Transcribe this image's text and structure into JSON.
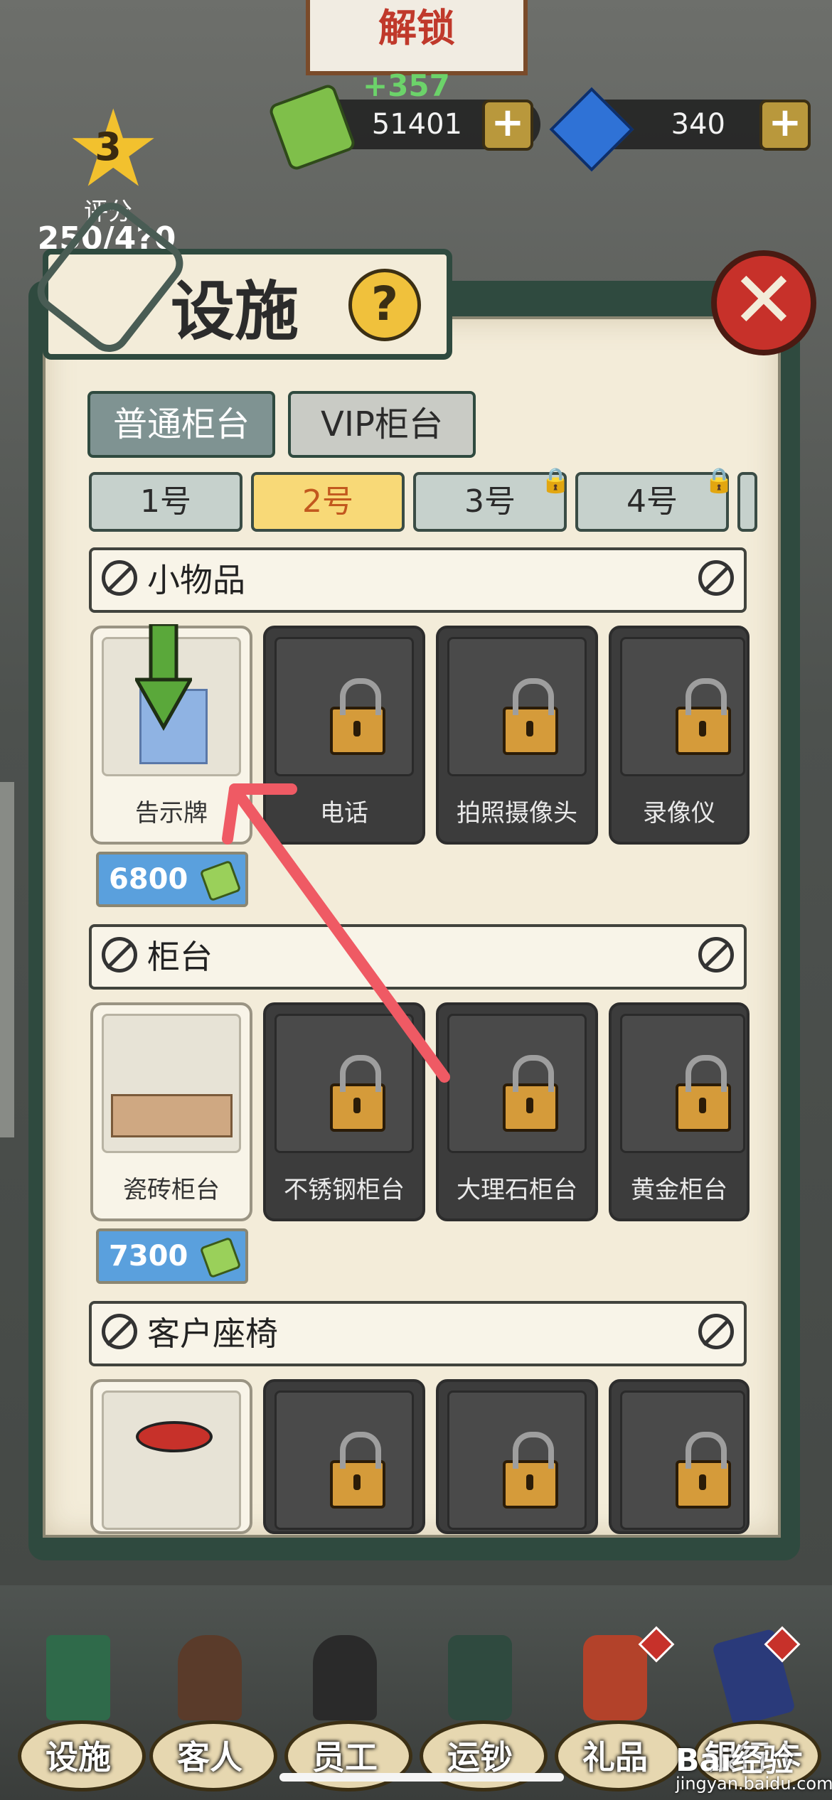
{
  "hud": {
    "sign_line2": "解锁",
    "cash_gain": "+357",
    "cash_value": "51401",
    "gem_value": "340",
    "rating_level": "3",
    "rating_label": "评分",
    "rating_value": "250/4?0"
  },
  "dialog": {
    "title": "设施",
    "help_symbol": "?",
    "close_symbol": "✕",
    "tabs": [
      {
        "label": "普通柜台",
        "active": true
      },
      {
        "label": "VIP柜台",
        "active": false
      }
    ],
    "slots": [
      {
        "label": "1号",
        "active": false,
        "locked": false
      },
      {
        "label": "2号",
        "active": true,
        "locked": false
      },
      {
        "label": "3号",
        "active": false,
        "locked": true
      },
      {
        "label": "4号",
        "active": false,
        "locked": true
      }
    ],
    "sections": [
      {
        "title": "小物品",
        "items": [
          {
            "name": "告示牌",
            "locked": false,
            "price": "6800"
          },
          {
            "name": "电话",
            "locked": true
          },
          {
            "name": "拍照摄像头",
            "locked": true
          },
          {
            "name": "录像仪",
            "locked": true
          }
        ]
      },
      {
        "title": "柜台",
        "items": [
          {
            "name": "瓷砖柜台",
            "locked": false,
            "price": "7300"
          },
          {
            "name": "不锈钢柜台",
            "locked": true
          },
          {
            "name": "大理石柜台",
            "locked": true
          },
          {
            "name": "黄金柜台",
            "locked": true
          }
        ]
      },
      {
        "title": "客户座椅",
        "items": [
          {
            "name": "",
            "locked": false
          },
          {
            "name": "",
            "locked": true
          },
          {
            "name": "",
            "locked": true
          },
          {
            "name": "",
            "locked": true
          }
        ]
      }
    ]
  },
  "nav": [
    {
      "label": "设施"
    },
    {
      "label": "客人"
    },
    {
      "label": "员工"
    },
    {
      "label": "运钞"
    },
    {
      "label": "礼品"
    },
    {
      "label": "银行卡"
    }
  ],
  "watermark": {
    "brand": "Bai经验",
    "site": "jingyan.baidu.com"
  },
  "colors": {
    "accent_green": "#2f4a3f",
    "active_slot": "#f8d977",
    "close_red": "#c7312a",
    "price_blue": "#5aa0dd"
  }
}
